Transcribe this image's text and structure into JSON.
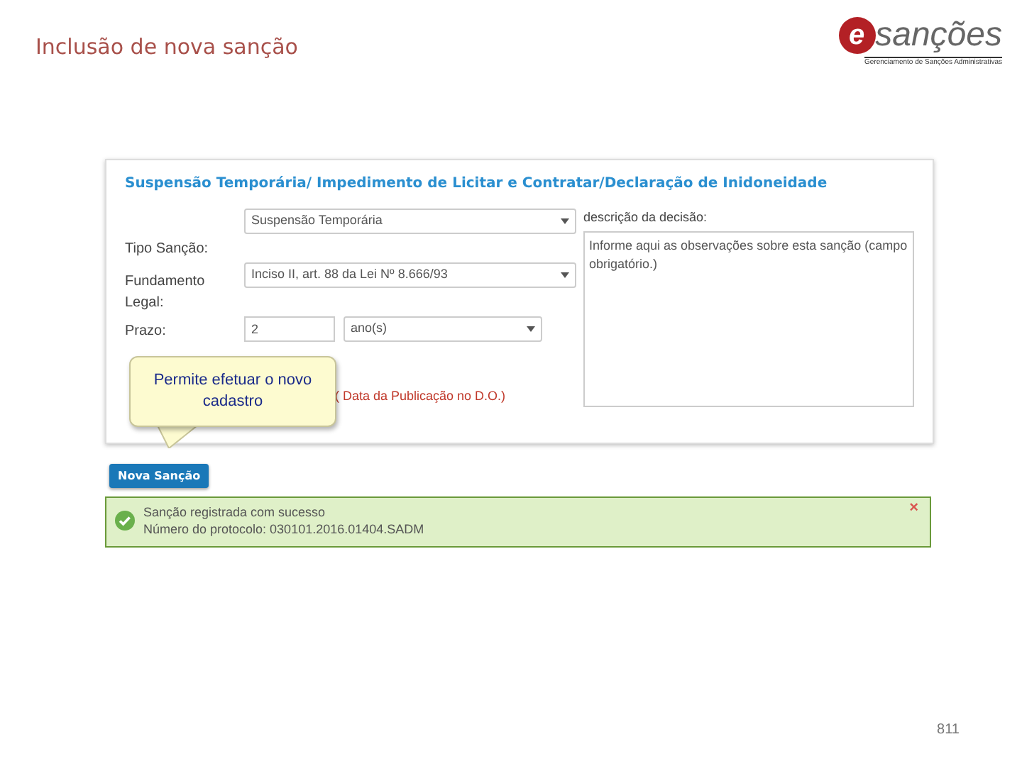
{
  "slide": {
    "title": "Inclusão de nova sanção",
    "page_number": "811"
  },
  "logo": {
    "letter": "e",
    "word": "sanções",
    "tagline": "Gerenciamento de Sanções Administrativas"
  },
  "form": {
    "heading": "Suspensão Temporária/ Impedimento de Licitar e Contratar/Declaração de Inidoneidade",
    "fields": [
      {
        "kind": "select",
        "label": "Tipo Sanção:",
        "value": "Suspensão Temporária"
      },
      {
        "kind": "select",
        "label": "Fundamento Legal:",
        "value": "Inciso II, art. 88 da Lei Nº 8.666/93"
      },
      {
        "kind": "term",
        "label": "Prazo:",
        "value": "2",
        "unit": "ano(s)"
      }
    ],
    "date_hint": "( Data da Publicação no D.O.)",
    "description": {
      "label": "descrição da decisão:",
      "placeholder": "Informe aqui as observações sobre esta sanção (campo obrigatório.)"
    }
  },
  "tooltip": {
    "text": "Permite efetuar o novo cadastro"
  },
  "button": {
    "label": "Nova Sanção"
  },
  "alert": {
    "kind": "success",
    "lines": [
      "Sanção registrada com sucesso",
      "Número do protocolo: 030101.2016.01404.SADM"
    ],
    "close": "×"
  }
}
